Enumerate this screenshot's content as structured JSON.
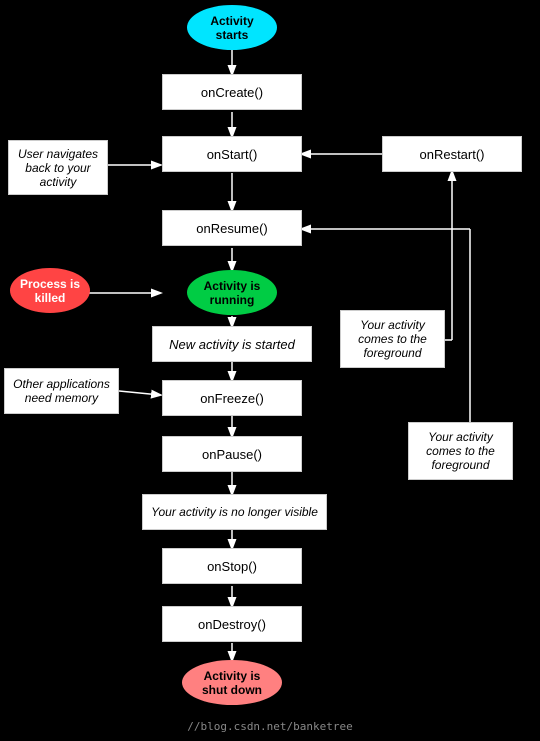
{
  "nodes": {
    "activity_starts": "Activity\nstarts",
    "onCreate": "onCreate()",
    "onStart": "onStart()",
    "onRestart": "onRestart()",
    "onResume": "onResume()",
    "activity_running": "Activity is\nrunning",
    "new_activity_started": "New activity is started",
    "your_activity_foreground1": "Your activity\ncomes to the\nforeground",
    "other_apps": "Other applications\nneed memory",
    "onFreeze": "onFreeze()",
    "your_activity_foreground2": "Your activity\ncomes to the\nforeground",
    "onPause": "onPause()",
    "no_longer_visible": "Your activity is no longer visible",
    "onStop": "onStop()",
    "onDestroy": "onDestroy()",
    "activity_shutdown": "Activity is\nshut down",
    "process_killed": "Process is\nkilled",
    "user_navigates": "User navigates\nback to your\nactivity"
  },
  "watermark": "//blog.csdn.net/banketree"
}
